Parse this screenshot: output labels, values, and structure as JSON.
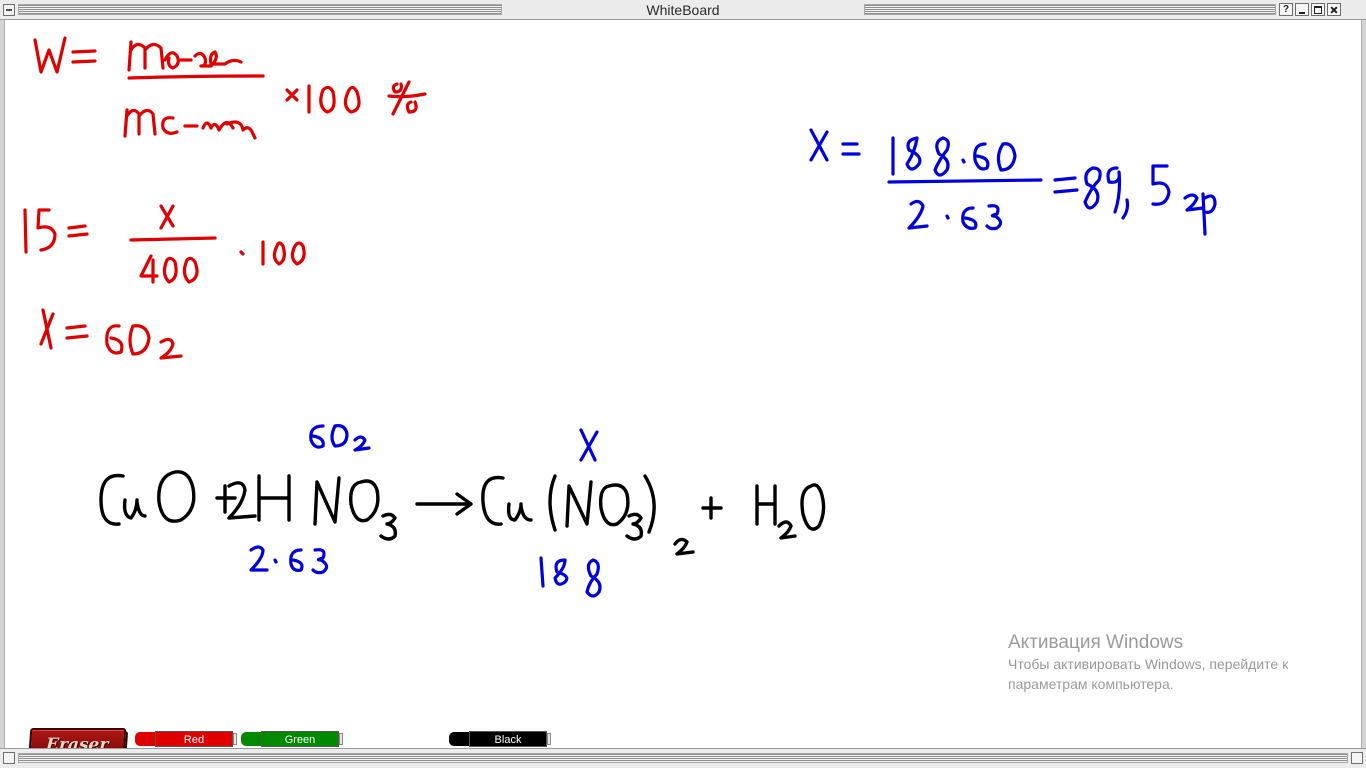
{
  "window": {
    "title": "WhiteBoard",
    "help_label": "?"
  },
  "whiteboard": {
    "formula": {
      "lhs": "W=",
      "numerator": "m в-ва",
      "denominator": "m с-ма",
      "multiplier": "×100 %",
      "color": "#e00000"
    },
    "substitution": {
      "lhs": "15=",
      "numerator": "x",
      "denominator": "400",
      "multiplier": "·100",
      "color": "#e00000"
    },
    "result_red": {
      "text": "x=60г",
      "color": "#e00000"
    },
    "equation": {
      "text": "CuO + 2HNO3 → Cu(NO3)2 + H2O",
      "color": "#000000"
    },
    "equation_annotations": {
      "above_hno3": "60г",
      "below_hno3": "2·63",
      "above_product": "x",
      "below_product": "188",
      "color": "#0000e0"
    },
    "result_blue": {
      "lhs": "x=",
      "numerator": "188·60",
      "denominator": "2·63",
      "result": "=89,5гр",
      "color": "#0000e0"
    }
  },
  "watermark": {
    "title": "Активация Windows",
    "line1": "Чтобы активировать Windows, перейдите к",
    "line2": "параметрам компьютера."
  },
  "toolbar": {
    "eraser_label": "Eraser",
    "markers": [
      {
        "label": "Red",
        "color": "#e00000"
      },
      {
        "label": "Green",
        "color": "#008a00"
      },
      {
        "label": "Black",
        "color": "#000000"
      }
    ]
  }
}
